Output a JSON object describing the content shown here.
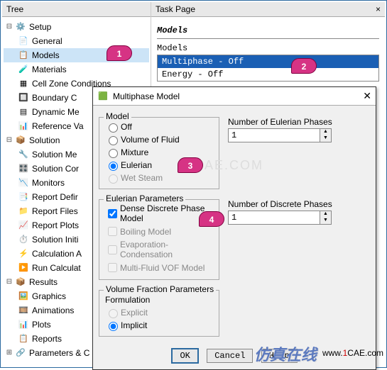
{
  "tree": {
    "header": "Tree",
    "setup": {
      "label": "Setup",
      "exp": "⊟"
    },
    "general": "General",
    "models": "Models",
    "materials": "Materials",
    "cellzone": "Cell Zone Conditions",
    "boundary": "Boundary C",
    "dynmesh": "Dynamic Me",
    "refval": "Reference Va",
    "solution": {
      "label": "Solution",
      "exp": "⊟"
    },
    "solmet": "Solution Me",
    "solcon": "Solution Cor",
    "monitors": "Monitors",
    "repdef": "Report Defir",
    "repfiles": "Report Files",
    "repplots": "Report Plots",
    "solinit": "Solution Initi",
    "calcact": "Calculation A",
    "runcalc": "Run Calculat",
    "results": {
      "label": "Results",
      "exp": "⊟"
    },
    "graphics": "Graphics",
    "anim": "Animations",
    "plots": "Plots",
    "reports": "Reports",
    "params": {
      "label": "Parameters & C",
      "exp": "⊞"
    }
  },
  "task": {
    "header": "Task Page",
    "close": "×",
    "section": "Models",
    "listLabel": "Models",
    "rows": [
      "Multiphase - Off",
      "Energy - Off"
    ]
  },
  "dialog": {
    "title": "Multiphase Model",
    "model": {
      "legend": "Model",
      "off": "Off",
      "vof": "Volume of Fluid",
      "mixture": "Mixture",
      "eulerian": "Eulerian",
      "wetsteam": "Wet Steam"
    },
    "numEuler": {
      "label": "Number of Eulerian Phases",
      "value": "1"
    },
    "numDisc": {
      "label": "Number of Discrete Phases",
      "value": "1"
    },
    "eparam": {
      "legend": "Eulerian Parameters",
      "dense": "Dense Discrete Phase Model",
      "boiling": "Boiling Model",
      "evap": "Evaporation-Condensation",
      "mfvof": "Multi-Fluid VOF Model"
    },
    "vfrac": {
      "legend": "Volume Fraction Parameters",
      "formulation": "Formulation",
      "explicit": "Explicit",
      "implicit": "Implicit"
    },
    "buttons": {
      "ok": "OK",
      "cancel": "Cancel",
      "help": "Help"
    }
  },
  "markers": {
    "m1": "1",
    "m2": "2",
    "m3": "3",
    "m4": "4"
  },
  "watermark": "1CAE.COM",
  "footer": {
    "cn": "仿真在线",
    "url1": "www.",
    "url2": "1",
    "url3": "CAE",
    "url4": ".com"
  }
}
